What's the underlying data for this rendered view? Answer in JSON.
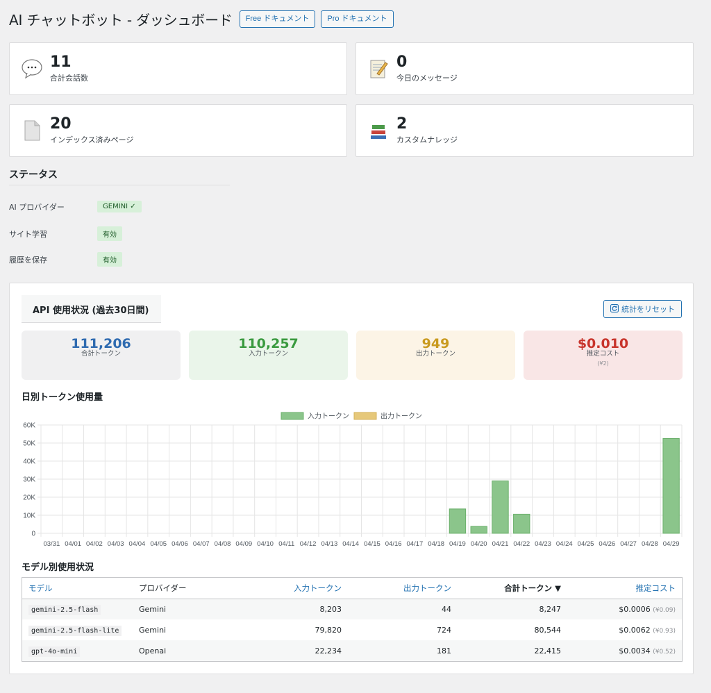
{
  "header": {
    "title": "AI チャットボット - ダッシュボード",
    "free_doc": "Free ドキュメント",
    "pro_doc": "Pro ドキュメント"
  },
  "stats": [
    {
      "value": "11",
      "label": "合計会話数",
      "icon": "speech-bubble-icon"
    },
    {
      "value": "0",
      "label": "今日のメッセージ",
      "icon": "memo-icon"
    },
    {
      "value": "20",
      "label": "インデックス済みページ",
      "icon": "page-icon"
    },
    {
      "value": "2",
      "label": "カスタムナレッジ",
      "icon": "books-icon"
    }
  ],
  "status": {
    "title": "ステータス",
    "rows": [
      {
        "key": "AI プロバイダー",
        "value": "GEMINI ✓"
      },
      {
        "key": "サイト学習",
        "value": "有効"
      },
      {
        "key": "履歴を保存",
        "value": "有効"
      }
    ]
  },
  "api": {
    "title": "API 使用状況 (過去30日間)",
    "reset_label": "統計をリセット",
    "metrics": [
      {
        "value": "111,206",
        "label": "合計トークン",
        "color": "#2f6bb0",
        "bg": "#f0f0f1"
      },
      {
        "value": "110,257",
        "label": "入力トークン",
        "color": "#3a9a3f",
        "bg": "#eaf5ea"
      },
      {
        "value": "949",
        "label": "出力トークン",
        "color": "#c99a1e",
        "bg": "#fcf4e6"
      },
      {
        "value": "$0.010",
        "label": "推定コスト",
        "sub": "(¥2)",
        "color": "#c8342c",
        "bg": "#f9e6e6"
      }
    ],
    "daily_title": "日別トークン使用量",
    "model_title": "モデル別使用状況"
  },
  "chart_data": {
    "type": "bar",
    "title": "",
    "legend": [
      "入力トークン",
      "出力トークン"
    ],
    "legend_colors": [
      "#8bc58b",
      "#e6c87a"
    ],
    "legend_position": "top",
    "grid": true,
    "ylim": [
      0,
      60000
    ],
    "yticks": [
      "0",
      "10K",
      "20K",
      "30K",
      "40K",
      "50K",
      "60K"
    ],
    "categories": [
      "03/31",
      "04/01",
      "04/02",
      "04/03",
      "04/04",
      "04/05",
      "04/06",
      "04/07",
      "04/08",
      "04/09",
      "04/10",
      "04/11",
      "04/12",
      "04/13",
      "04/14",
      "04/15",
      "04/16",
      "04/17",
      "04/18",
      "04/19",
      "04/20",
      "04/21",
      "04/22",
      "04/23",
      "04/24",
      "04/25",
      "04/26",
      "04/27",
      "04/28",
      "04/29"
    ],
    "series": [
      {
        "name": "入力トークン",
        "values": [
          0,
          0,
          0,
          0,
          0,
          0,
          0,
          0,
          0,
          0,
          0,
          0,
          0,
          0,
          0,
          0,
          0,
          0,
          0,
          13500,
          3800,
          29000,
          10600,
          0,
          0,
          0,
          0,
          0,
          0,
          52500
        ]
      },
      {
        "name": "出力トークン",
        "values": [
          0,
          0,
          0,
          0,
          0,
          0,
          0,
          0,
          0,
          0,
          0,
          0,
          0,
          0,
          0,
          0,
          0,
          0,
          0,
          0,
          0,
          0,
          0,
          0,
          0,
          0,
          0,
          0,
          0,
          0
        ]
      }
    ]
  },
  "model_table": {
    "headers": [
      "モデル",
      "プロバイダー",
      "入力トークン",
      "出力トークン",
      "合計トークン ▼",
      "推定コスト"
    ],
    "rows": [
      {
        "model": "gemini-2.5-flash",
        "provider": "Gemini",
        "input": "8,203",
        "output": "44",
        "total": "8,247",
        "cost": "$0.0006",
        "yen": "(¥0.09)"
      },
      {
        "model": "gemini-2.5-flash-lite",
        "provider": "Gemini",
        "input": "79,820",
        "output": "724",
        "total": "80,544",
        "cost": "$0.0062",
        "yen": "(¥0.93)"
      },
      {
        "model": "gpt-4o-mini",
        "provider": "Openai",
        "input": "22,234",
        "output": "181",
        "total": "22,415",
        "cost": "$0.0034",
        "yen": "(¥0.52)"
      }
    ]
  }
}
